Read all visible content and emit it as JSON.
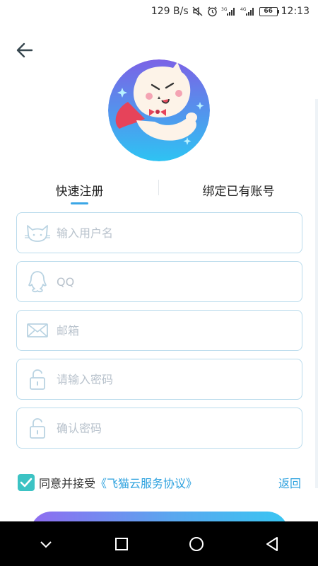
{
  "status_bar": {
    "net_speed": "129 B/s",
    "battery": "66",
    "time": "12:13",
    "icons": [
      "mute-icon",
      "alarm-icon",
      "signal-3g-icon",
      "signal-4g-icon",
      "battery-icon"
    ]
  },
  "header": {
    "back_icon": "back-arrow-icon"
  },
  "avatar": {
    "description_icon": "cat-mascot-avatar"
  },
  "tabs": [
    {
      "label": "快速注册",
      "active": true
    },
    {
      "label": "绑定已有账号",
      "active": false
    }
  ],
  "form": {
    "fields": [
      {
        "icon": "cat-icon",
        "placeholder": "输入用户名",
        "value": ""
      },
      {
        "icon": "qq-icon",
        "placeholder": "QQ",
        "value": ""
      },
      {
        "icon": "mail-icon",
        "placeholder": "邮箱",
        "value": ""
      },
      {
        "icon": "lock-icon",
        "placeholder": "请输入密码",
        "value": ""
      },
      {
        "icon": "lock-icon",
        "placeholder": "确认密码",
        "value": ""
      }
    ]
  },
  "agreement": {
    "checked": true,
    "text": "同意并接受",
    "link": "《飞猫云服务协议》",
    "return_label": "返回"
  },
  "nav_bar": {
    "items": [
      "chevron-down-icon",
      "recent-apps-icon",
      "home-icon",
      "back-triangle-icon"
    ]
  },
  "colors": {
    "accent": "#2aa0de",
    "field_border": "#b9dbec",
    "checkbox": "#3cc3c4",
    "button_gradient_start": "#8f6cf0",
    "button_gradient_end": "#39c6f2"
  }
}
